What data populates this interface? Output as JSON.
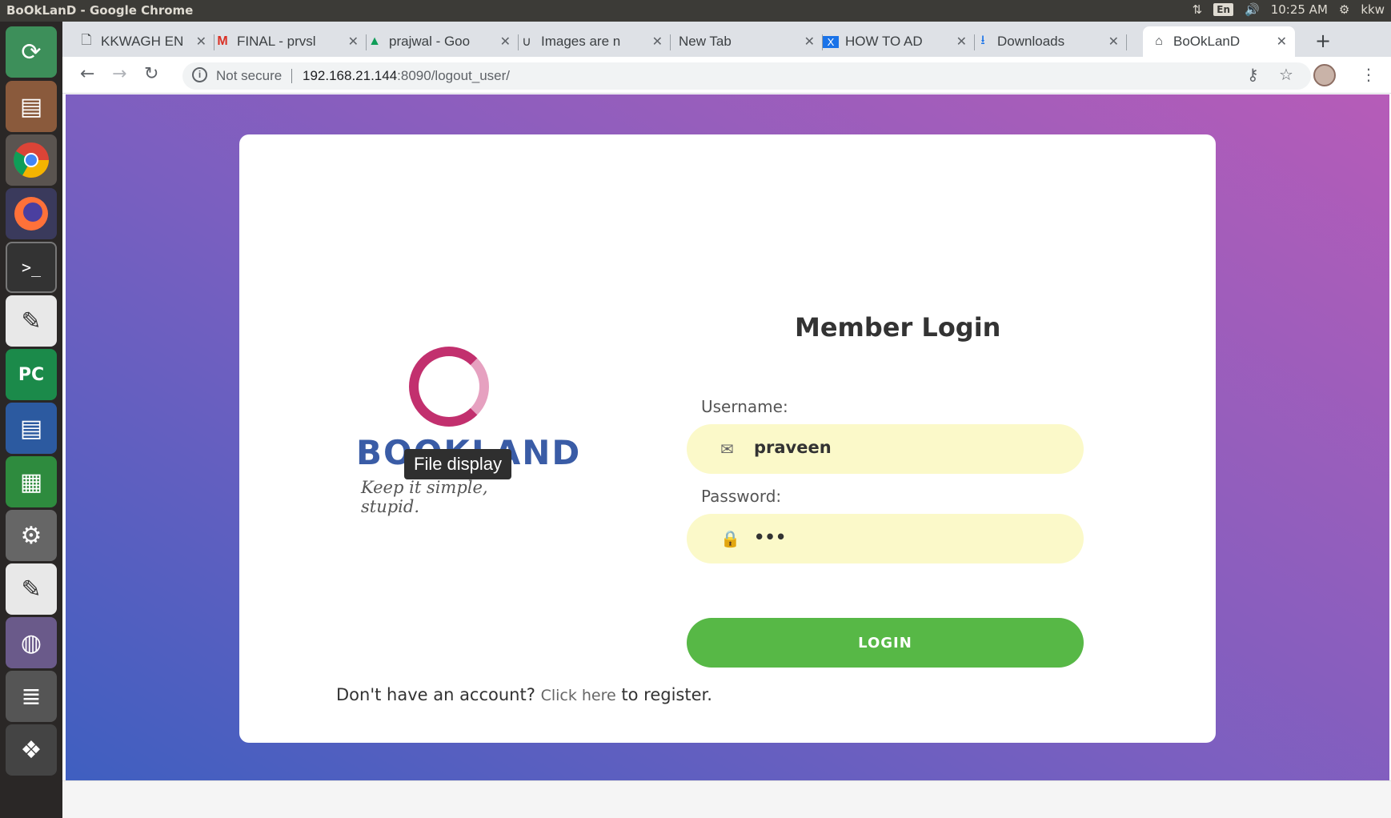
{
  "os": {
    "window_title": "BoOkLanD - Google Chrome",
    "time": "10:25 AM",
    "input_lang": "En",
    "user": "kkw"
  },
  "browser": {
    "tabs": [
      {
        "title": "KKWAGH EN",
        "icon": "page-icon"
      },
      {
        "title": "FINAL - prvsl",
        "icon": "gmail-icon"
      },
      {
        "title": "prajwal - Goo",
        "icon": "drive-icon"
      },
      {
        "title": "Images are n",
        "icon": "magnet-icon"
      },
      {
        "title": "New Tab",
        "icon": ""
      },
      {
        "title": "HOW TO AD",
        "icon": "x-icon"
      },
      {
        "title": "Downloads",
        "icon": "download-icon"
      },
      {
        "title": "BoOkLanD",
        "icon": "home-icon"
      }
    ],
    "active_tab": 7,
    "security": "Not secure",
    "url_host": "192.168.21.144",
    "url_path": ":8090/logout_user/"
  },
  "page": {
    "logo_text": "BOOKLAND",
    "logo_tagline": "Keep it simple, stupid.",
    "tooltip": "File display",
    "heading": "Member Login",
    "username_label": "Username:",
    "username_value": "praveen",
    "password_label": "Password:",
    "password_value": "•••",
    "login_label": "LOGIN",
    "register_prefix": "Don't have an account?",
    "register_link": "Click here",
    "register_suffix": "to register."
  },
  "colors": {
    "gradient_start": "#3f5fc0",
    "gradient_end": "#b65cb8",
    "field_bg": "#fbf9c9",
    "login_button": "#57b846",
    "logo_ring": "#c2306e",
    "logo_text": "#3a5ca6"
  }
}
